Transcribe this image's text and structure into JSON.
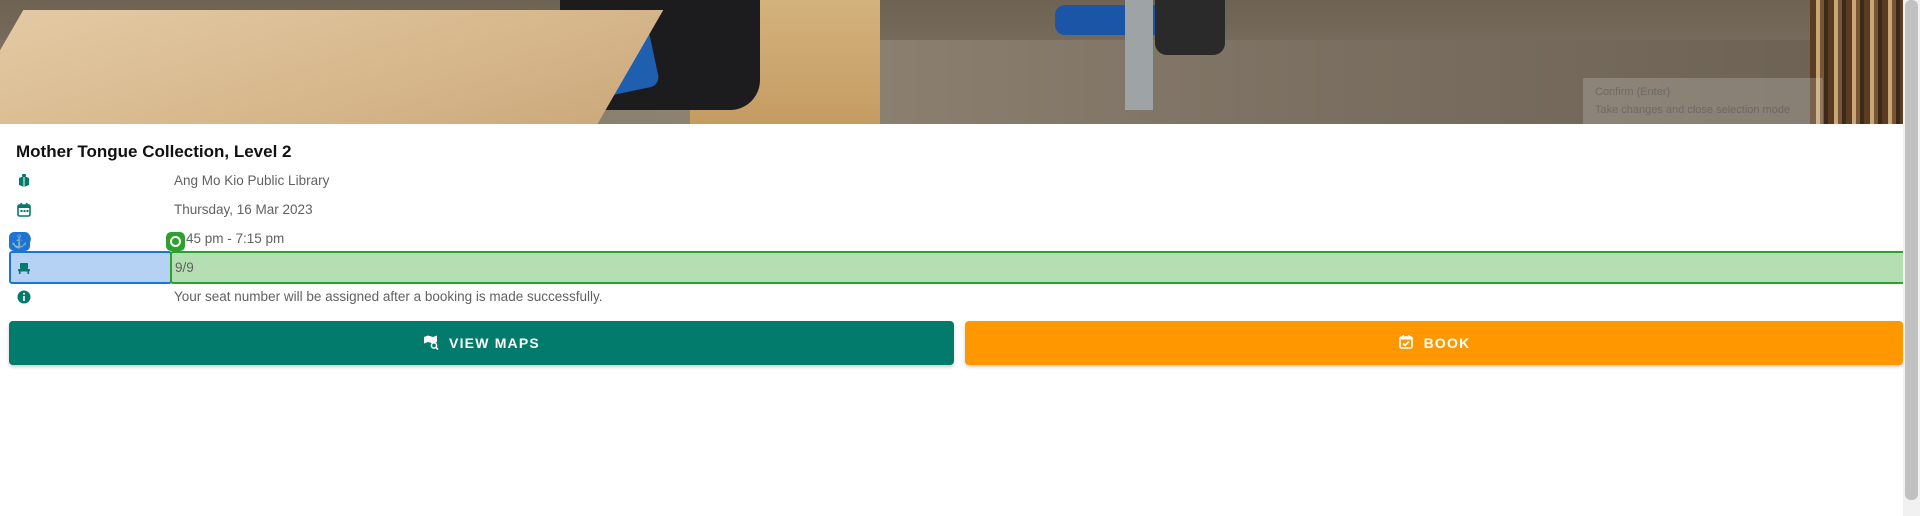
{
  "hero": {
    "image_alt": "Library reading area with tables and chairs",
    "tooltip_title": "Confirm (Enter)",
    "tooltip_desc": "Take changes and close selection mode"
  },
  "title": "Mother Tongue Collection, Level 2",
  "details": {
    "library": {
      "icon": "book-icon",
      "value": "Ang Mo Kio Public Library"
    },
    "date": {
      "icon": "calendar-icon",
      "value": "Thursday, 16 Mar 2023"
    },
    "time": {
      "icon": "clock-icon",
      "value": "45 pm - 7:15 pm"
    },
    "seats": {
      "icon": "seat-icon",
      "value": "9/9"
    },
    "info": {
      "icon": "info-icon",
      "value": "Your seat number will be assigned after a booking is made successfully."
    }
  },
  "overlay": {
    "anchor_badge": "⚓",
    "selection_colors": {
      "blue": "#1e74d6",
      "green": "#2ea02e"
    }
  },
  "buttons": {
    "view_maps": {
      "label": "VIEW MAPS",
      "icon": "map-search-icon"
    },
    "book": {
      "label": "BOOK",
      "icon": "calendar-check-icon"
    }
  },
  "colors": {
    "primary": "#037b6c",
    "accent": "#ff9800",
    "text": "#616161"
  }
}
